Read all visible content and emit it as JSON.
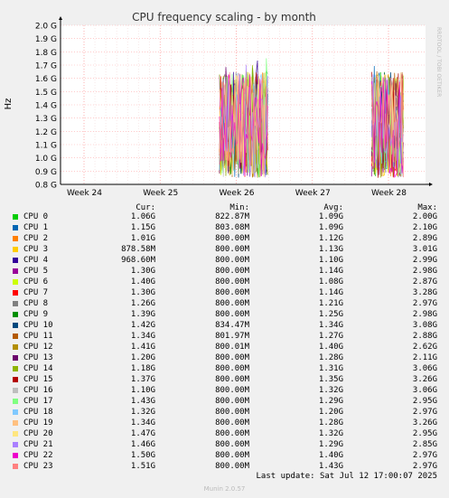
{
  "chart_data": {
    "type": "line",
    "title": "CPU frequency scaling - by month",
    "ylabel": "Hz",
    "watermark": "RRDTOOL / TOBI OETIKER",
    "ylim": [
      0.8,
      2.0
    ],
    "yticks": [
      "0.8 G",
      "0.9 G",
      "1.0 G",
      "1.1 G",
      "1.2 G",
      "1.3 G",
      "1.4 G",
      "1.5 G",
      "1.6 G",
      "1.7 G",
      "1.8 G",
      "1.9 G",
      "2.0 G"
    ],
    "ytick_values": [
      0.8,
      0.9,
      1.0,
      1.1,
      1.2,
      1.3,
      1.4,
      1.5,
      1.6,
      1.7,
      1.8,
      1.9,
      2.0
    ],
    "x_ticks": [
      "Week 24",
      "Week 25",
      "Week 26",
      "Week 27",
      "Week 28"
    ],
    "grid": true,
    "data_windows": [
      {
        "from_week": 25.78,
        "to_week": 26.42
      },
      {
        "from_week": 27.78,
        "to_week": 28.2
      }
    ],
    "series_colors": [
      "#00cc00",
      "#0066b3",
      "#ff8000",
      "#ffcc00",
      "#330099",
      "#990099",
      "#ccff00",
      "#ff0000",
      "#808080",
      "#008f00",
      "#00487d",
      "#b35a00",
      "#b38f00",
      "#6b006b",
      "#8fb300",
      "#b30000",
      "#bebebe",
      "#80ff80",
      "#80c9ff",
      "#ffc080",
      "#ffe680",
      "#aa80ff",
      "#ee00cc",
      "#ff8080"
    ],
    "legend": {
      "headers": {
        "cur": "Cur:",
        "min": "Min:",
        "avg": "Avg:",
        "max": "Max:"
      },
      "rows": [
        {
          "name": "CPU 0",
          "cur": "1.06G",
          "min": "822.87M",
          "avg": "1.09G",
          "max": "2.00G"
        },
        {
          "name": "CPU 1",
          "cur": "1.15G",
          "min": "803.08M",
          "avg": "1.09G",
          "max": "2.10G"
        },
        {
          "name": "CPU 2",
          "cur": "1.01G",
          "min": "800.00M",
          "avg": "1.12G",
          "max": "2.89G"
        },
        {
          "name": "CPU 3",
          "cur": "878.58M",
          "min": "800.00M",
          "avg": "1.13G",
          "max": "3.01G"
        },
        {
          "name": "CPU 4",
          "cur": "968.60M",
          "min": "800.00M",
          "avg": "1.10G",
          "max": "2.99G"
        },
        {
          "name": "CPU 5",
          "cur": "1.30G",
          "min": "800.00M",
          "avg": "1.14G",
          "max": "2.98G"
        },
        {
          "name": "CPU 6",
          "cur": "1.40G",
          "min": "800.00M",
          "avg": "1.08G",
          "max": "2.87G"
        },
        {
          "name": "CPU 7",
          "cur": "1.30G",
          "min": "800.00M",
          "avg": "1.14G",
          "max": "3.28G"
        },
        {
          "name": "CPU 8",
          "cur": "1.26G",
          "min": "800.00M",
          "avg": "1.21G",
          "max": "2.97G"
        },
        {
          "name": "CPU 9",
          "cur": "1.39G",
          "min": "800.00M",
          "avg": "1.25G",
          "max": "2.98G"
        },
        {
          "name": "CPU 10",
          "cur": "1.42G",
          "min": "834.47M",
          "avg": "1.34G",
          "max": "3.08G"
        },
        {
          "name": "CPU 11",
          "cur": "1.34G",
          "min": "801.97M",
          "avg": "1.27G",
          "max": "2.88G"
        },
        {
          "name": "CPU 12",
          "cur": "1.41G",
          "min": "800.01M",
          "avg": "1.40G",
          "max": "2.62G"
        },
        {
          "name": "CPU 13",
          "cur": "1.20G",
          "min": "800.00M",
          "avg": "1.28G",
          "max": "2.11G"
        },
        {
          "name": "CPU 14",
          "cur": "1.18G",
          "min": "800.00M",
          "avg": "1.31G",
          "max": "3.06G"
        },
        {
          "name": "CPU 15",
          "cur": "1.37G",
          "min": "800.00M",
          "avg": "1.35G",
          "max": "3.26G"
        },
        {
          "name": "CPU 16",
          "cur": "1.10G",
          "min": "800.00M",
          "avg": "1.32G",
          "max": "3.06G"
        },
        {
          "name": "CPU 17",
          "cur": "1.43G",
          "min": "800.00M",
          "avg": "1.29G",
          "max": "2.95G"
        },
        {
          "name": "CPU 18",
          "cur": "1.32G",
          "min": "800.00M",
          "avg": "1.20G",
          "max": "2.97G"
        },
        {
          "name": "CPU 19",
          "cur": "1.34G",
          "min": "800.00M",
          "avg": "1.28G",
          "max": "3.26G"
        },
        {
          "name": "CPU 20",
          "cur": "1.47G",
          "min": "800.00M",
          "avg": "1.32G",
          "max": "2.95G"
        },
        {
          "name": "CPU 21",
          "cur": "1.46G",
          "min": "800.00M",
          "avg": "1.29G",
          "max": "2.85G"
        },
        {
          "name": "CPU 22",
          "cur": "1.50G",
          "min": "800.00M",
          "avg": "1.40G",
          "max": "2.97G"
        },
        {
          "name": "CPU 23",
          "cur": "1.51G",
          "min": "800.00M",
          "avg": "1.43G",
          "max": "2.97G"
        }
      ]
    },
    "last_update": "Last update: Sat Jul 12 17:00:07 2025",
    "footer": "Munin 2.0.57"
  }
}
